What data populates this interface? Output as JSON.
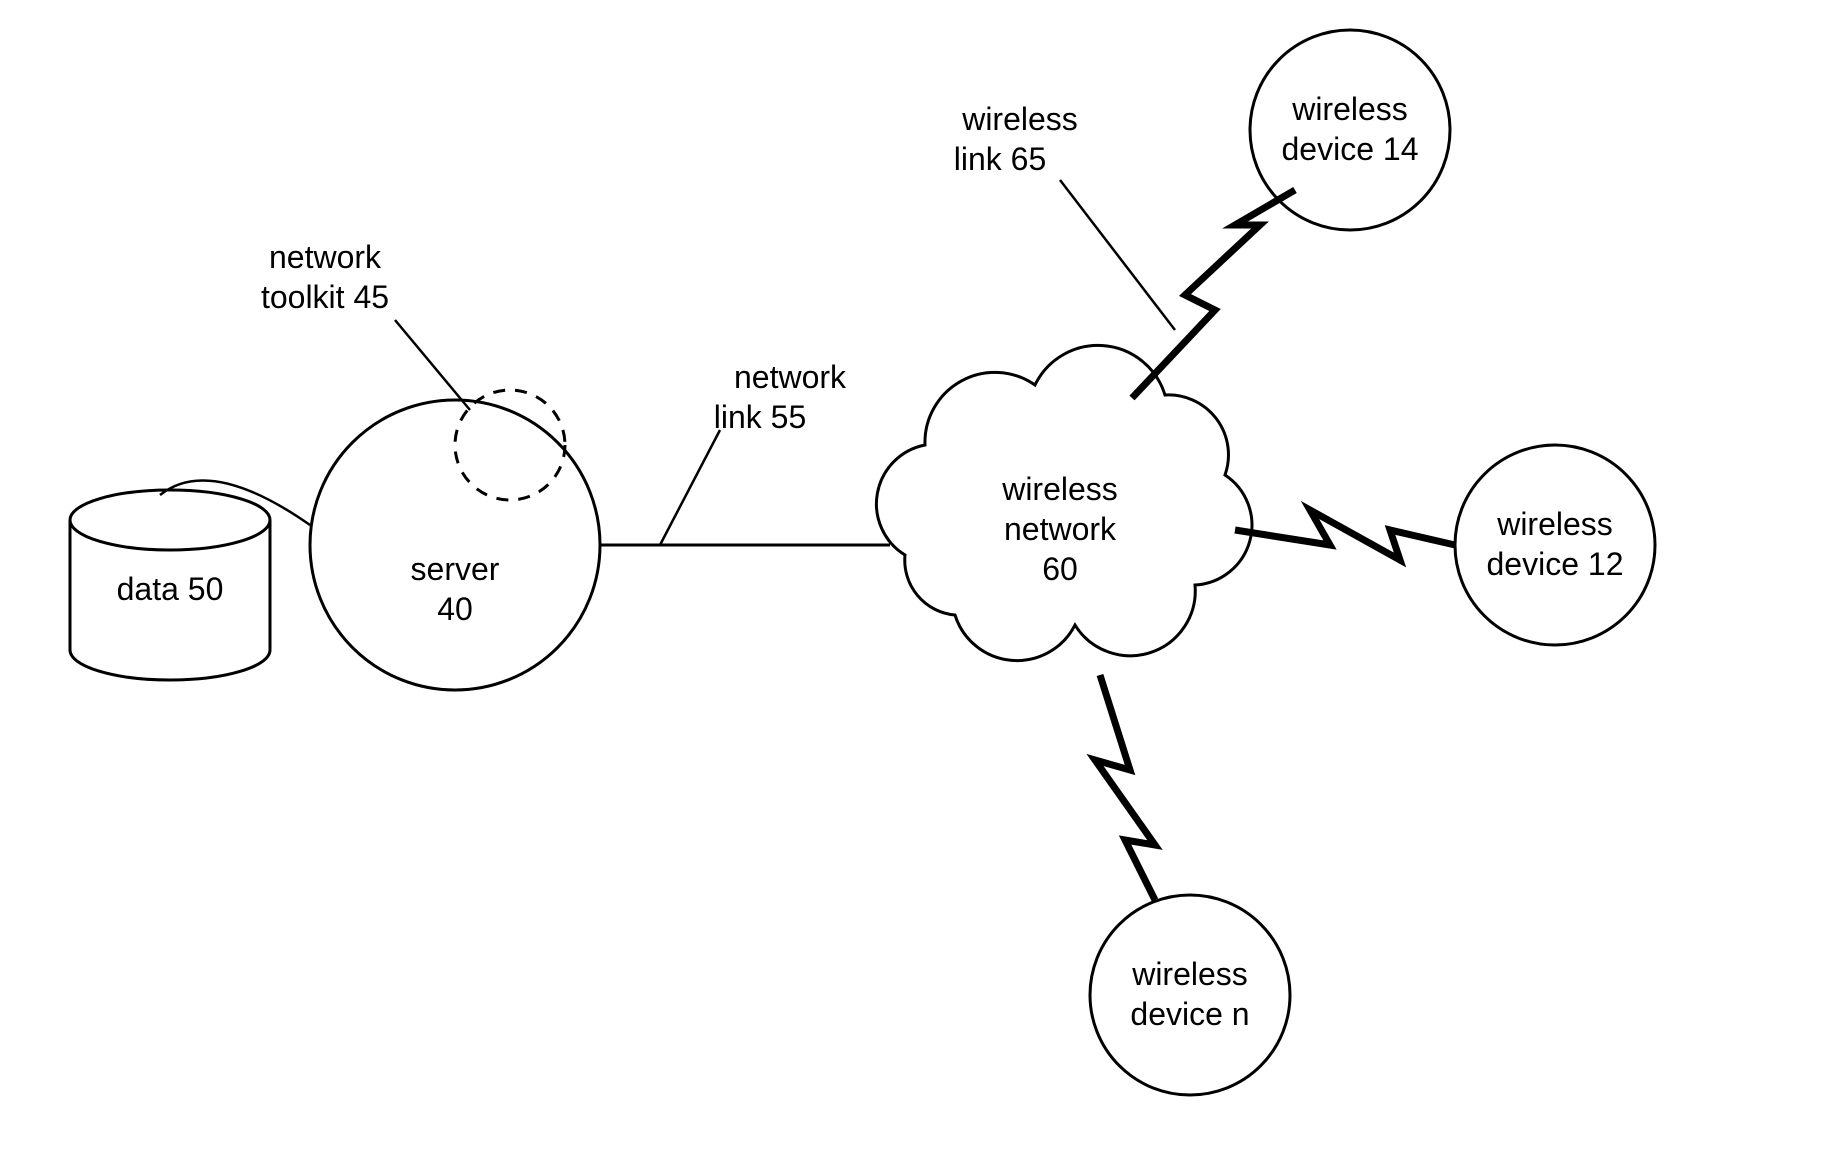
{
  "nodes": {
    "data": {
      "line1": "data 50"
    },
    "server": {
      "line1": "server",
      "line2": "40"
    },
    "toolkit_label": {
      "line1": "network",
      "line2": "toolkit 45"
    },
    "network_link_label": {
      "line1": "network",
      "line2": "link 55"
    },
    "wireless_link_label": {
      "line1": "wireless",
      "line2": "link 65"
    },
    "cloud": {
      "line1": "wireless",
      "line2": "network",
      "line3": "60"
    },
    "dev14": {
      "line1": "wireless",
      "line2": "device 14"
    },
    "dev12": {
      "line1": "wireless",
      "line2": "device 12"
    },
    "devn": {
      "line1": "wireless",
      "line2": "device n"
    }
  }
}
